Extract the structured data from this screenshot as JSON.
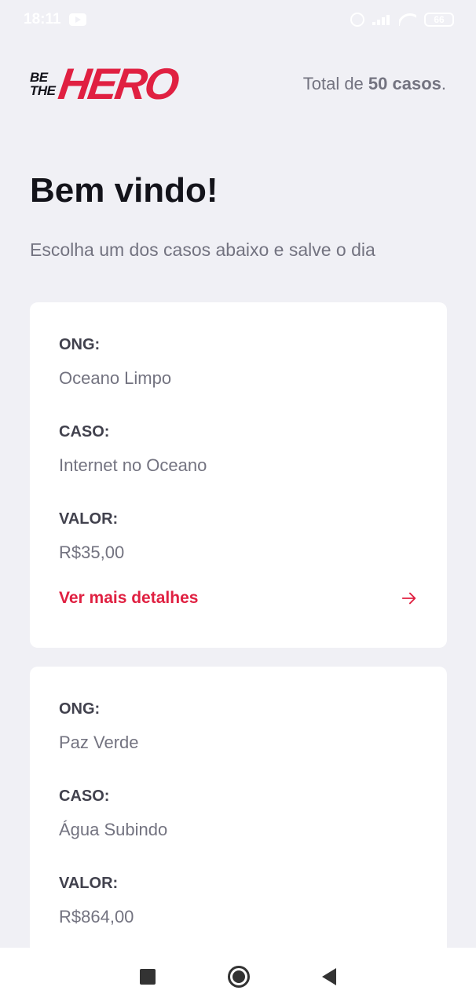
{
  "status_bar": {
    "time": "18:11",
    "battery": "66"
  },
  "header": {
    "logo_small_line1": "BE",
    "logo_small_line2": "THE",
    "logo_big": "HERO",
    "total_prefix": "Total de ",
    "total_count": "50 casos",
    "total_suffix": "."
  },
  "title": "Bem vindo!",
  "subtitle": "Escolha um dos casos abaixo e salve o dia",
  "incidents": [
    {
      "ong_label": "ONG:",
      "ong_value": "Oceano Limpo",
      "caso_label": "CASO:",
      "caso_value": "Internet no Oceano",
      "valor_label": "VALOR:",
      "valor_value": "R$35,00",
      "details_label": "Ver mais detalhes"
    },
    {
      "ong_label": "ONG:",
      "ong_value": "Paz Verde",
      "caso_label": "CASO:",
      "caso_value": "Água Subindo",
      "valor_label": "VALOR:",
      "valor_value": "R$864,00"
    }
  ],
  "colors": {
    "brand": "#e02041",
    "background": "#f0f0f5",
    "text_dark": "#13131a",
    "text_muted": "#737380"
  },
  "icons": {
    "details_arrow": "arrow-right-icon",
    "nav_recent": "square-icon",
    "nav_home": "circle-icon",
    "nav_back": "triangle-back-icon"
  }
}
